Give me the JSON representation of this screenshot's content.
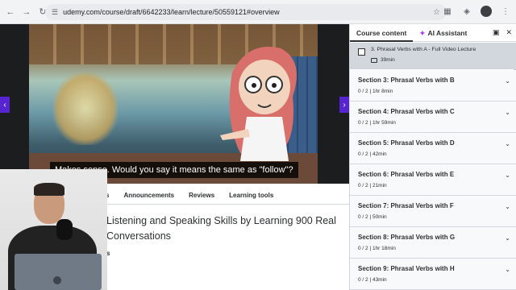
{
  "browser": {
    "url": "udemy.com/course/draft/6642233/learn/lecture/50559121#overview"
  },
  "video": {
    "caption": "Makes sense. Would you say it means the same as \"follow\"?",
    "progress": 0.02,
    "prev_label": "‹",
    "next_label": "›"
  },
  "tabs": [
    "s",
    "Announcements",
    "Reviews",
    "Learning tools"
  ],
  "course": {
    "title": "Listening and Speaking Skills by Learning 900 Real Conversations",
    "byline": "s"
  },
  "sidebar": {
    "tab_content": "Course content",
    "tab_ai": "AI Assistant",
    "lecture": {
      "title": "3. Phrasal Verbs with A - Full Video Lecture",
      "duration": "39min"
    },
    "sections": [
      {
        "title": "Section 3: Phrasal Verbs with B",
        "meta": "0 / 2 | 1hr 8min"
      },
      {
        "title": "Section 4: Phrasal Verbs with C",
        "meta": "0 / 2 | 1hr 59min"
      },
      {
        "title": "Section 5: Phrasal Verbs with D",
        "meta": "0 / 2 | 42min"
      },
      {
        "title": "Section 6: Phrasal Verbs with E",
        "meta": "0 / 2 | 21min"
      },
      {
        "title": "Section 7: Phrasal Verbs with F",
        "meta": "0 / 2 | 50min"
      },
      {
        "title": "Section 8: Phrasal Verbs with G",
        "meta": "0 / 2 | 1hr 18min"
      },
      {
        "title": "Section 9: Phrasal Verbs with H",
        "meta": "0 / 2 | 43min"
      }
    ]
  },
  "colors": {
    "accent": "#5624d0",
    "progress": "#a435f0"
  }
}
